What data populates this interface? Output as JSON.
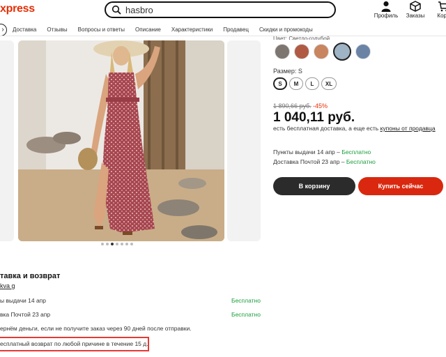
{
  "header": {
    "logo_text": "xpress",
    "search_value": "hasbro",
    "icons": [
      {
        "name": "profile",
        "label": "Профиль"
      },
      {
        "name": "orders",
        "label": "Заказы"
      },
      {
        "name": "cart",
        "label": "Корз"
      }
    ]
  },
  "nav": {
    "items": [
      "Доставка",
      "Отзывы",
      "Вопросы и ответы",
      "Описание",
      "Характеристики",
      "Продавец",
      "Скидки и промокоды"
    ]
  },
  "gallery": {
    "dots_total": 7,
    "dots_active_index": 2
  },
  "product": {
    "color_label": "Цвет: Светло-голубой",
    "size_label": "Размер: S",
    "sizes": [
      "S",
      "M",
      "L",
      "XL"
    ],
    "selected_size": "S",
    "old_price": "1 890,66 руб.",
    "discount": "-45%",
    "price": "1 040,11 руб.",
    "shipping_text": "есть бесплатная доставка, а еще есть",
    "shipping_link": "купоны от продавца",
    "pickup_text": "Пункты выдачи 14 апр –",
    "pickup_value": "Бесплатно",
    "post_text": "Доставка Почтой 23 апр –",
    "post_value": "Бесплатно",
    "cart_button": "В корзину",
    "buy_button": "Купить сейчас"
  },
  "delivery": {
    "title": "тавка и возврат",
    "link": "kva g",
    "rows": [
      {
        "label": "ы выдачи 14 апр",
        "value": "Бесплатно"
      },
      {
        "label": "вка Почтой 23 апр",
        "value": "Бесплатно"
      }
    ],
    "refund_text": "ернём деньги, если не получите заказ через 90 дней после отправки.",
    "return_text": "есплатный возврат по любой причине в течение 15 д."
  },
  "colors": {
    "accent": "#e62e04",
    "buy": "#d9280f",
    "cart": "#2b2b2b",
    "free": "#1a9e3b",
    "highlight": "#e53935"
  }
}
